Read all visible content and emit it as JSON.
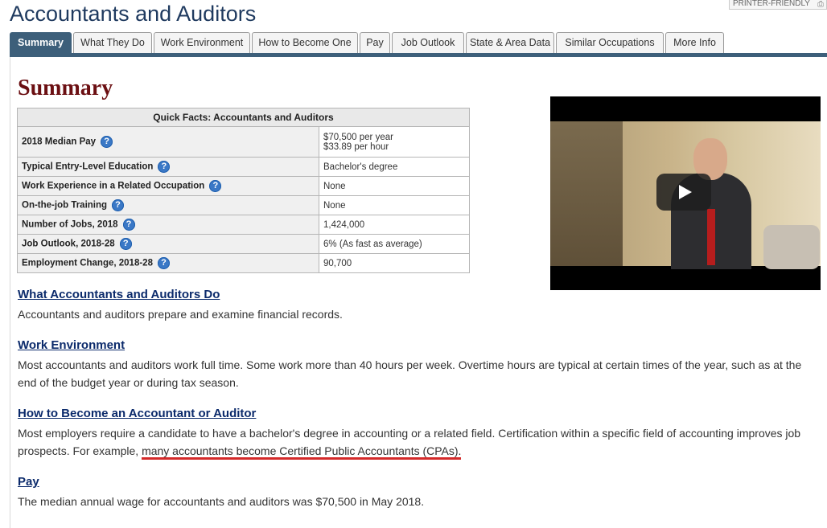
{
  "page": {
    "title": "Accountants and Auditors",
    "printer_label": "PRINTER-FRIENDLY"
  },
  "tabs": [
    {
      "label": "Summary",
      "active": true
    },
    {
      "label": "What They Do"
    },
    {
      "label": "Work Environment"
    },
    {
      "label": "How to Become One"
    },
    {
      "label": "Pay"
    },
    {
      "label": "Job Outlook"
    },
    {
      "label": "State & Area Data"
    },
    {
      "label": "Similar Occupations"
    },
    {
      "label": "More Info"
    }
  ],
  "summary": {
    "heading": "Summary",
    "quick_facts": {
      "caption": "Quick Facts: Accountants and Auditors",
      "rows": [
        {
          "label": "2018 Median Pay",
          "value": "$70,500 per year",
          "value2": "$33.89 per hour"
        },
        {
          "label": "Typical Entry-Level Education",
          "value": "Bachelor's degree"
        },
        {
          "label": "Work Experience in a Related Occupation",
          "value": "None"
        },
        {
          "label": "On-the-job Training",
          "value": "None"
        },
        {
          "label": "Number of Jobs, 2018",
          "value": "1,424,000"
        },
        {
          "label": "Job Outlook, 2018-28",
          "value": "6% (As fast as average)"
        },
        {
          "label": "Employment Change, 2018-28",
          "value": "90,700"
        }
      ]
    }
  },
  "sections": {
    "what_they_do": {
      "heading": "What Accountants and Auditors Do",
      "text": "Accountants and auditors prepare and examine financial records."
    },
    "work_environment": {
      "heading": "Work Environment",
      "text": "Most accountants and auditors work full time. Some work more than 40 hours per week. Overtime hours are typical at certain times of the year, such as at the end of the budget year or during tax season."
    },
    "how_to_become": {
      "heading": "How to Become an Accountant or Auditor",
      "text_before": "Most employers require a candidate to have a bachelor's degree in accounting or a related field. Certification within a specific field of accounting improves job prospects. For example, ",
      "text_highlight": "many accountants become Certified Public Accountants (CPAs)."
    },
    "pay": {
      "heading": "Pay",
      "text": "The median annual wage for accountants and auditors was $70,500 in May 2018."
    }
  },
  "icons": {
    "help": "help-question-icon",
    "printer": "printer-icon",
    "play": "play-icon"
  },
  "colors": {
    "tab_active": "#3d5f7a",
    "heading": "#6b0f12",
    "link": "#0b2a6b",
    "highlight_underline": "#d42a2a"
  }
}
